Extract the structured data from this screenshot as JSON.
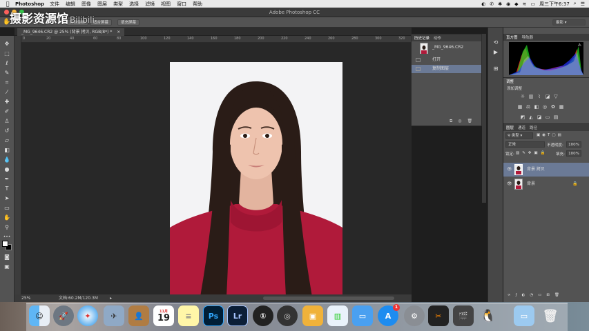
{
  "menubar": {
    "app_name": "Photoshop",
    "items": [
      "文件",
      "编辑",
      "图像",
      "图层",
      "类型",
      "选择",
      "滤镜",
      "视图",
      "窗口",
      "帮助"
    ],
    "clock": "周三下午6:37"
  },
  "window": {
    "title": "Adobe Photoshop CC"
  },
  "watermark": {
    "text": "摄影资源馆",
    "sub": "Bilibili"
  },
  "options": {
    "btn_actual": "实际像素",
    "btn_fit": "适合屏幕",
    "btn_fill": "填充屏幕",
    "workspace": "摄影"
  },
  "document": {
    "tab_label": "_MG_9646.CR2 @ 25% (背景 拷贝, RGB/8*) *",
    "zoom": "25%",
    "doc_size": "文档:60.2M/120.3M",
    "ruler_ticks": [
      "0",
      "20",
      "40",
      "60",
      "80",
      "100",
      "120",
      "140",
      "160",
      "180",
      "200",
      "220",
      "240",
      "260",
      "280",
      "300",
      "320"
    ]
  },
  "history": {
    "tabs": [
      "历史记录",
      "动作"
    ],
    "snapshot_name": "_MG_9646.CR2",
    "steps": [
      "打开",
      "复制图层"
    ]
  },
  "histogram": {
    "tabs": [
      "直方图",
      "导航器"
    ]
  },
  "adjustments": {
    "tab": "调整",
    "label": "添加调整"
  },
  "layers": {
    "tabs": [
      "图层",
      "通道",
      "路径"
    ],
    "filter": "类型",
    "blend_mode": "正常",
    "opacity_label": "不透明度:",
    "opacity_value": "100%",
    "lock_label": "锁定:",
    "fill_label": "填充:",
    "fill_value": "100%",
    "items": [
      {
        "name": "背景 拷贝",
        "selected": true
      },
      {
        "name": "背景",
        "selected": false
      }
    ]
  },
  "dock": {
    "calendar_day": "19",
    "calendar_month": "11月",
    "ps_label": "Ps",
    "lr_label": "Lr",
    "appstore_badge": "1"
  },
  "colors": {
    "ps_blue": "#31a8ff",
    "lr_blue": "#a8c6ff",
    "shirt_red": "#b01a3a",
    "selected_layer": "#6b7a96"
  }
}
